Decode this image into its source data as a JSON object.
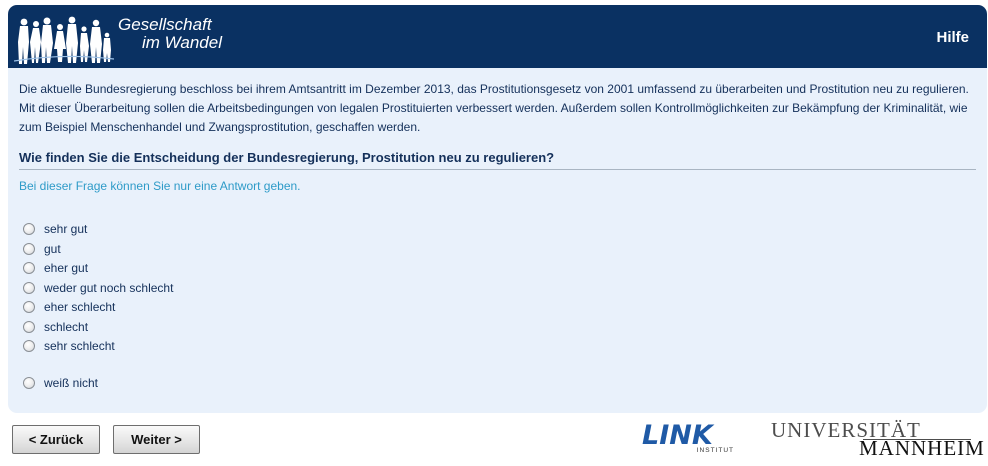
{
  "header": {
    "logo_line1": "Gesellschaft",
    "logo_line2": "im Wandel",
    "help_label": "Hilfe",
    "bg_color": "#0a3162"
  },
  "main": {
    "intro": "Die aktuelle Bundesregierung beschloss bei ihrem Amtsantritt im Dezember 2013, das Prostitutionsgesetz von 2001 umfassend zu überarbeiten und Prostitution neu zu regulieren. Mit dieser Überarbeitung sollen die Arbeitsbedingungen von legalen Prostituierten verbessert werden. Außerdem sollen Kontrollmöglichkeiten zur Bekämpfung der Kriminalität, wie zum Beispiel Menschenhandel und Zwangsprostitution, geschaffen werden.",
    "question": "Wie finden Sie die Entscheidung der Bundesregierung, Prostitution neu zu regulieren?",
    "hint": "Bei dieser Frage können Sie nur eine Antwort geben.",
    "options": [
      "sehr gut",
      "gut",
      "eher gut",
      "weder gut noch schlecht",
      "eher schlecht",
      "schlecht",
      "sehr schlecht"
    ],
    "dont_know": "weiß nicht"
  },
  "footer": {
    "back_label": "< Zurück",
    "next_label": "Weiter >",
    "link_logo": "LINK",
    "link_sub": "INSTITUT",
    "uni_top": "UNIVERSITÄT",
    "uni_bottom": "MANNHEIM"
  }
}
